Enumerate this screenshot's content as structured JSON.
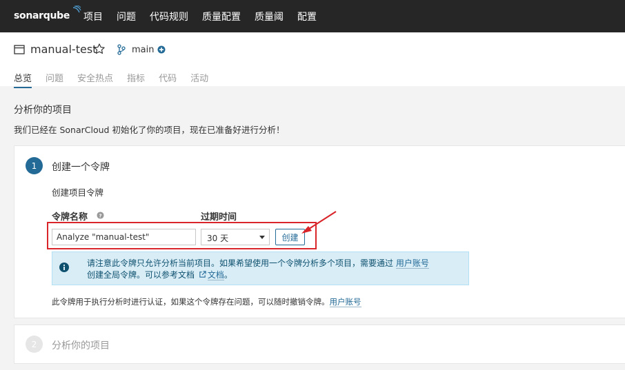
{
  "nav": {
    "logo": "sonarqube",
    "items": [
      "项目",
      "问题",
      "代码规则",
      "质量配置",
      "质量阈",
      "配置"
    ]
  },
  "project": {
    "name": "manual-test",
    "branch": "main",
    "tabs": [
      "总览",
      "问题",
      "安全热点",
      "指标",
      "代码",
      "活动"
    ]
  },
  "page": {
    "title": "分析你的项目",
    "description": "我们已经在 SonarCloud 初始化了你的项目，现在已准备好进行分析！"
  },
  "step1": {
    "number": "1",
    "title": "创建一个令牌",
    "subtitle": "创建项目令牌",
    "token_name_label": "令牌名称",
    "expiration_label": "过期时间",
    "token_name_value": "Analyze \"manual-test\"",
    "expiration_value": "30 天",
    "create_button": "创建",
    "info_text_1": "请注意此令牌只允许分析当前项目。如果希望使用一个令牌分析多个项目，需要通过",
    "info_link_account": "用户账号",
    "info_text_2": "创建全局令牌。可以参考文档",
    "info_link_docs": "文档",
    "info_text_3": "。",
    "footnote_text": "此令牌用于执行分析时进行认证，如果这个令牌存在问题，可以随时撤销令牌。",
    "footnote_link": "用户账号"
  },
  "step2": {
    "number": "2",
    "title": "分析你的项目"
  },
  "colors": {
    "topnav": "#262626",
    "accent": "#236a97",
    "highlight": "#d9252a",
    "info_bg": "#d9edf7"
  }
}
